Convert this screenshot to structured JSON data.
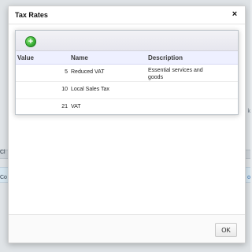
{
  "background": {
    "left_fragment_1": "Cl",
    "left_fragment_2": "Co",
    "right_fragment_1": "k",
    "right_fragment_2": "o"
  },
  "dialog": {
    "title": "Tax Rates",
    "close_icon": "×",
    "ok_label": "OK"
  },
  "table": {
    "add_icon": "+",
    "columns": [
      "Value",
      "Name",
      "Description"
    ],
    "rows": [
      {
        "value": "5",
        "name": "Reduced VAT",
        "description": "Essential services and goods"
      },
      {
        "value": "10",
        "name": "Local Sales Tax",
        "description": ""
      },
      {
        "value": "21",
        "name": "VAT",
        "description": ""
      }
    ]
  }
}
